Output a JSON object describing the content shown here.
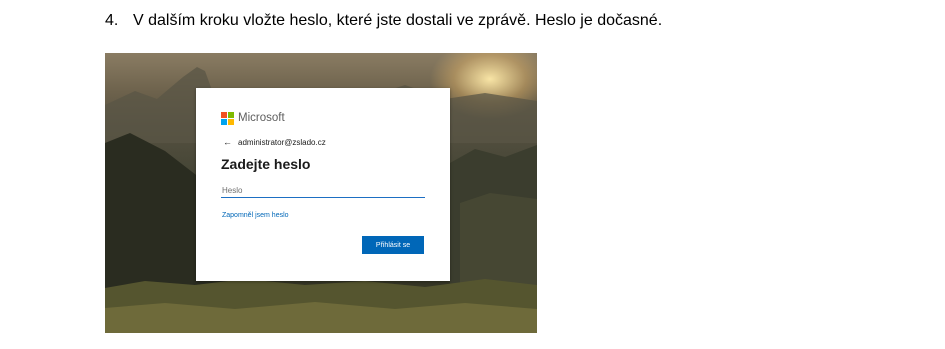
{
  "instruction": {
    "number": "4.",
    "text": "V dalším kroku vložte heslo, které jste dostali ve zprávě. Heslo je dočasné."
  },
  "login": {
    "brand_name": "Microsoft",
    "brand_colors": [
      "#f25022",
      "#7fba00",
      "#00a4ef",
      "#ffb900"
    ],
    "back_icon": "arrow-left-icon",
    "account": "administrator@zslado.cz",
    "title": "Zadejte heslo",
    "password_placeholder": "Heslo",
    "password_value": "",
    "forgot_link": "Zapomněl jsem heslo",
    "submit_label": "Přihlásit se",
    "accent_color": "#0067b8"
  }
}
